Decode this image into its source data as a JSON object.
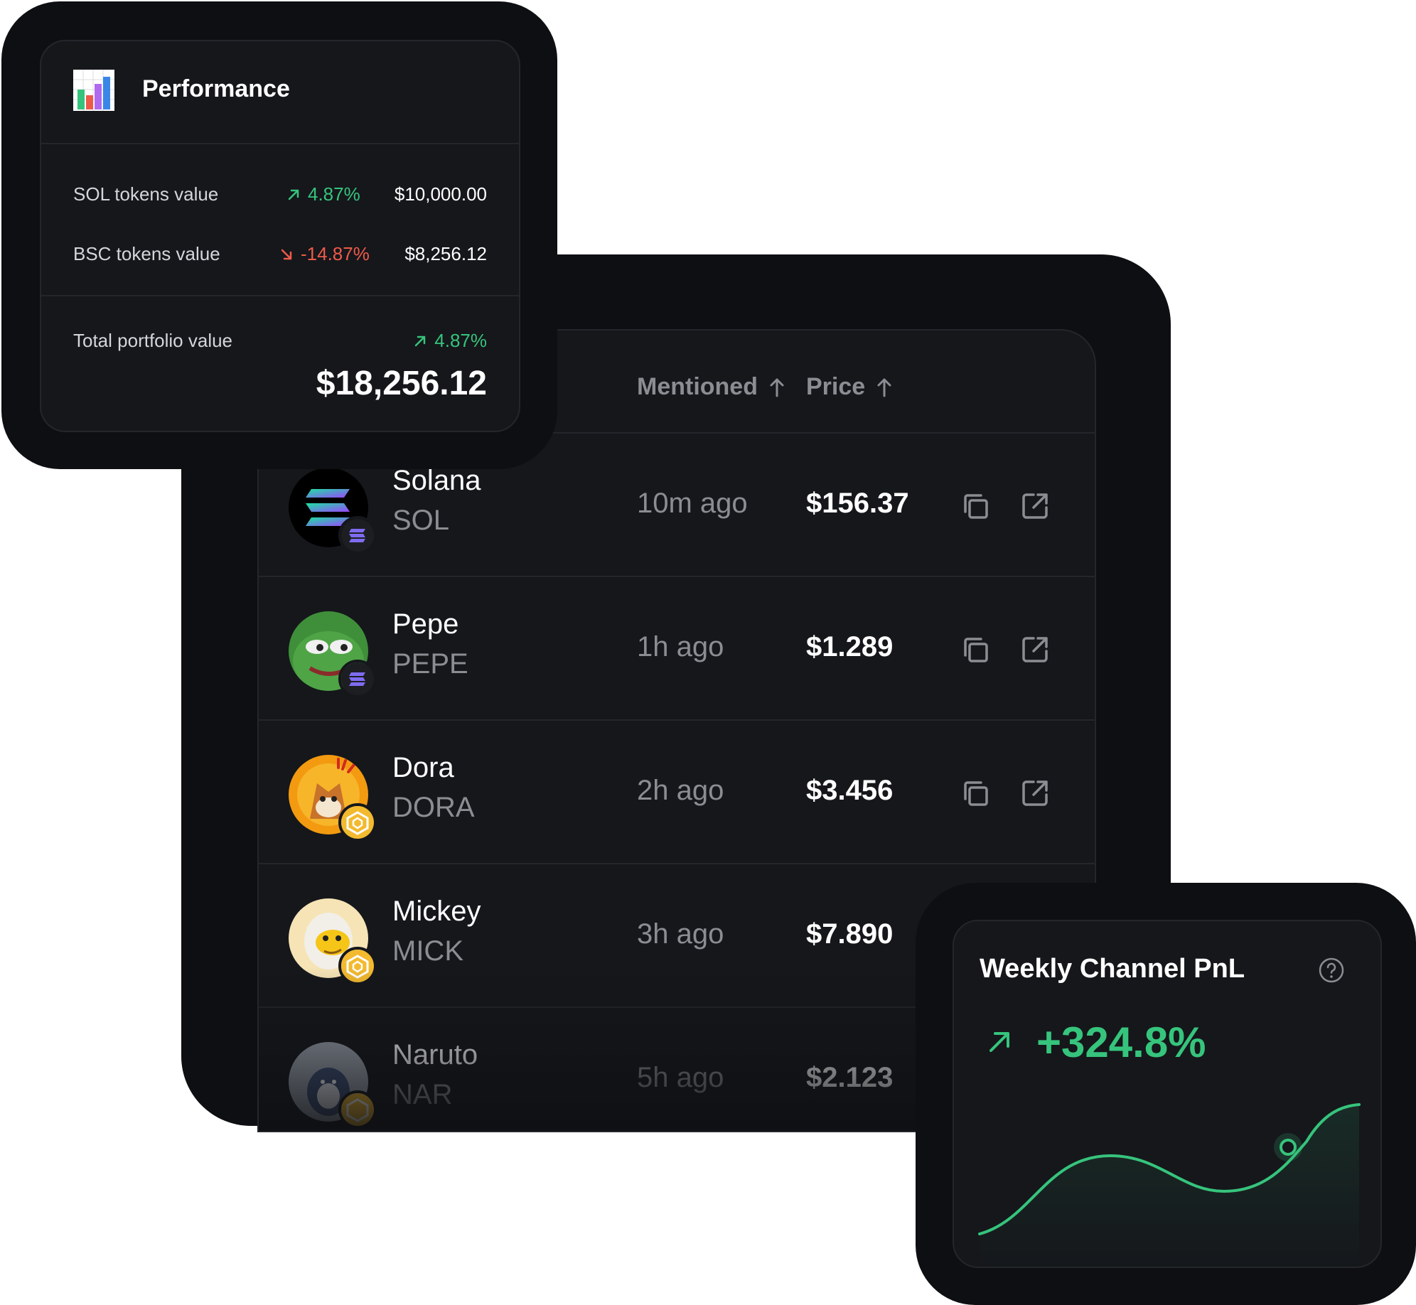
{
  "performance": {
    "title": "Performance",
    "icon": "bar-chart-icon",
    "rows": [
      {
        "label": "SOL tokens value",
        "change": "4.87%",
        "direction": "up",
        "value": "$10,000.00"
      },
      {
        "label": "BSC tokens value",
        "change": "-14.87%",
        "direction": "down",
        "value": "$8,256.12"
      }
    ],
    "total": {
      "label": "Total portfolio value",
      "change": "4.87%",
      "direction": "up",
      "value": "$18,256.12"
    }
  },
  "table": {
    "columns": {
      "mentioned": "Mentioned",
      "price": "Price"
    },
    "rows": [
      {
        "name": "Solana",
        "symbol": "SOL",
        "mentioned": "10m ago",
        "price": "$156.37",
        "chain": "solana"
      },
      {
        "name": "Pepe",
        "symbol": "PEPE",
        "mentioned": "1h ago",
        "price": "$1.289",
        "chain": "solana"
      },
      {
        "name": "Dora",
        "symbol": "DORA",
        "mentioned": "2h ago",
        "price": "$3.456",
        "chain": "bnb"
      },
      {
        "name": "Mickey",
        "symbol": "MICK",
        "mentioned": "3h ago",
        "price": "$7.890",
        "chain": "bnb"
      },
      {
        "name": "Naruto",
        "symbol": "NAR",
        "mentioned": "5h ago",
        "price": "$2.123",
        "chain": "bnb"
      }
    ]
  },
  "pnl": {
    "title": "Weekly Channel PnL",
    "value": "+324.8%",
    "direction": "up"
  },
  "colors": {
    "positive": "#36c47c",
    "negative": "#ee5a4a",
    "background_card": "#15171b",
    "background_frame": "#0e0f12",
    "muted_text": "#8b8d93"
  }
}
